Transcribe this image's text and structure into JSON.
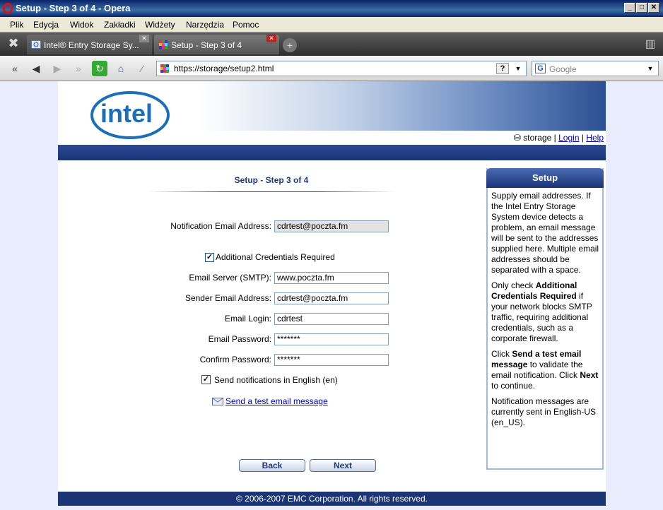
{
  "window": {
    "title": "Setup - Step 3 of 4 - Opera"
  },
  "menu": [
    "Plik",
    "Edycja",
    "Widok",
    "Zakładki",
    "Widżety",
    "Narzędzia",
    "Pomoc"
  ],
  "tabs": [
    {
      "label": "Intel® Entry Storage Sy..."
    },
    {
      "label": "Setup - Step 3 of 4"
    }
  ],
  "address": {
    "url": "https://storage/setup2.html",
    "search_placeholder": "Google"
  },
  "header": {
    "storage_label": "storage",
    "login_link": "Login",
    "help_link": "Help",
    "separator": "|"
  },
  "form": {
    "title": "Setup - Step 3 of 4",
    "notification_email_label": "Notification Email Address:",
    "notification_email_value": "cdrtest@poczta.fm",
    "additional_credentials_label": "Additional Credentials Required",
    "additional_credentials_checked": true,
    "smtp_label": "Email Server (SMTP):",
    "smtp_value": "www.poczta.fm",
    "sender_label": "Sender Email Address:",
    "sender_value": "cdrtest@poczta.fm",
    "login_label": "Email Login:",
    "login_value": "cdrtest",
    "password_label": "Email Password:",
    "password_value": "*******",
    "confirm_label": "Confirm Password:",
    "confirm_value": "*******",
    "english_label": "Send notifications in English (en)",
    "english_checked": true,
    "test_link": "Send a test email message",
    "back_button": "Back",
    "next_button": "Next"
  },
  "sidebar": {
    "title": "Setup",
    "p1": "Supply email addresses. If the Intel Entry Storage System device detects a problem, an email message will be sent to the addresses supplied here. Multiple email addresses should be separated with a space.",
    "p2_pre": "Only check ",
    "p2_bold": "Additional Credentials Required",
    "p2_post": " if your network blocks SMTP traffic, requiring additional credentials, such as a corporate firewall.",
    "p3_pre": "Click ",
    "p3_bold1": "Send a test email message",
    "p3_mid": " to validate the email notification. Click ",
    "p3_bold2": "Next",
    "p3_post": " to continue.",
    "p4": "Notification messages are currently sent in English-US (en_US)."
  },
  "footer": {
    "copyright": "© 2006-2007 EMC Corporation. All rights reserved."
  },
  "colors": {
    "brand_blue": "#1b3474",
    "link": "#0000cc",
    "title": "#1d3a7a"
  }
}
